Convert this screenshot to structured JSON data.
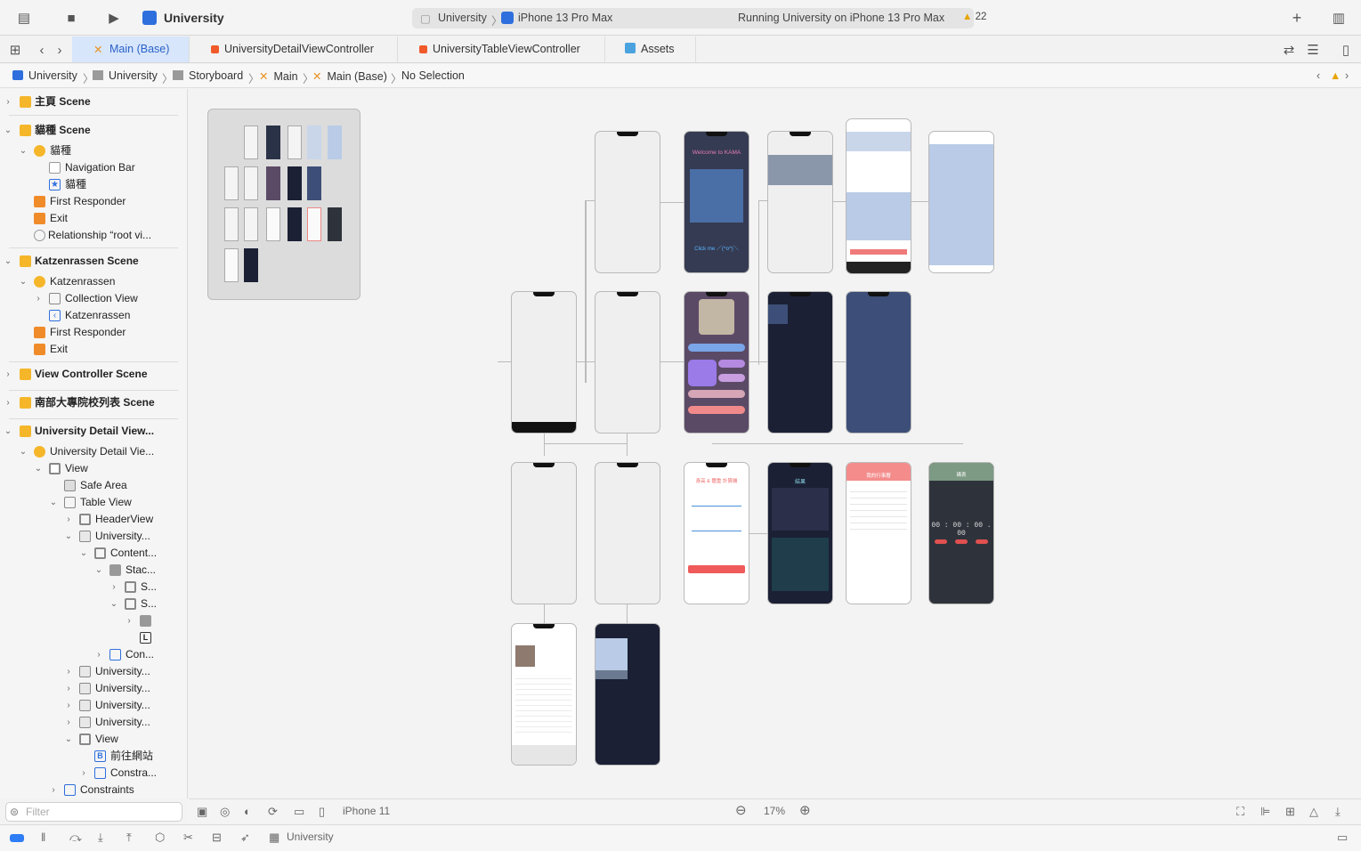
{
  "toolbar": {
    "app_title": "University",
    "scheme": "University",
    "device": "iPhone 13 Pro Max",
    "status": "Running University on iPhone 13 Pro Max",
    "warning_count": "22"
  },
  "tabs": [
    {
      "label": "Main (Base)",
      "active": true
    },
    {
      "label": "UniversityDetailViewController"
    },
    {
      "label": "UniversityTableViewController"
    },
    {
      "label": "Assets"
    }
  ],
  "breadcrumb": [
    "University",
    "University",
    "Storyboard",
    "Main",
    "Main (Base)",
    "No Selection"
  ],
  "outline": {
    "s1": "主頁 Scene",
    "s2": "貓種 Scene",
    "s2_items": [
      "貓種",
      "Navigation Bar",
      "貓種",
      "First Responder",
      "Exit",
      "Relationship “root vi..."
    ],
    "s3": "Katzenrassen Scene",
    "s3_items": [
      "Katzenrassen",
      "Collection View",
      "Katzenrassen",
      "First Responder",
      "Exit"
    ],
    "s4": "View Controller Scene",
    "s5": "南部大專院校列表 Scene",
    "s6": "University Detail View...",
    "s6_items": [
      "University Detail Vie...",
      "View",
      "Safe Area",
      "Table View",
      "HeaderView",
      "University...",
      "Content...",
      "Stac...",
      "S...",
      "S...",
      "",
      "",
      "Con...",
      "University...",
      "University...",
      "University...",
      "University...",
      "View",
      "前往網站",
      "Constra...",
      "Constraints"
    ]
  },
  "filter_placeholder": "Filter",
  "canvas": {
    "phone_texts": {
      "welcome": "Welcome to KAMA",
      "click": "Click me  ／(^o^)＼",
      "timer": "00 : 00 : 00 . 00",
      "calc_title": "身高 & 體重 計算機",
      "result": "結果",
      "timer_title": "碼表",
      "cal_title": "我的行事曆"
    }
  },
  "bottom": {
    "device_label": "iPhone 11",
    "zoom": "17%"
  },
  "debug": {
    "target": "University"
  },
  "colors": {
    "accent": "#2a62c8",
    "dark_screen": "#1b2035",
    "navy_screen": "#3d4f78",
    "light_blue_screen": "#b9cbe6",
    "warning": "#f2b61b"
  }
}
